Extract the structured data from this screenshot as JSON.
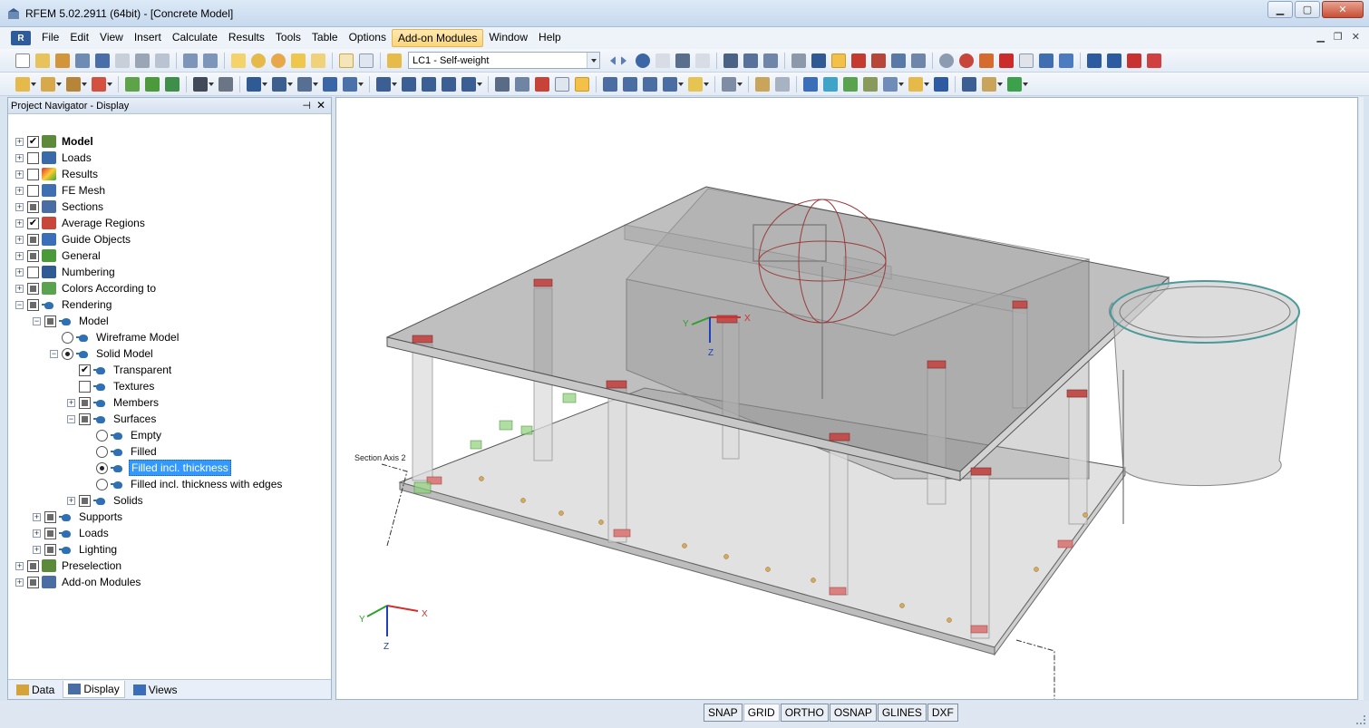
{
  "window": {
    "title": "RFEM 5.02.2911 (64bit) - [Concrete Model]",
    "minimize": "▁",
    "maximize": "▢",
    "close": "✕"
  },
  "menu": {
    "items": [
      {
        "label": "File"
      },
      {
        "label": "Edit"
      },
      {
        "label": "View"
      },
      {
        "label": "Insert"
      },
      {
        "label": "Calculate"
      },
      {
        "label": "Results"
      },
      {
        "label": "Tools"
      },
      {
        "label": "Table"
      },
      {
        "label": "Options"
      },
      {
        "label": "Add-on Modules",
        "active": true
      },
      {
        "label": "Window"
      },
      {
        "label": "Help"
      }
    ],
    "mdi_min": "▁",
    "mdi_restore": "❐",
    "mdi_close": "✕"
  },
  "toolbar": {
    "load_case": "LC1 - Self-weight"
  },
  "navigator": {
    "title": "Project Navigator - Display",
    "pin": "⊣",
    "close": "✕",
    "tree": [
      {
        "label": "Model",
        "level": 0,
        "expander": "+",
        "check": "checked",
        "icon": "model-icon",
        "bold": true
      },
      {
        "label": "Loads",
        "level": 0,
        "expander": "+",
        "check": "unchecked",
        "icon": "loads-icon"
      },
      {
        "label": "Results",
        "level": 0,
        "expander": "+",
        "check": "unchecked",
        "icon": "results-icon"
      },
      {
        "label": "FE Mesh",
        "level": 0,
        "expander": "+",
        "check": "unchecked",
        "icon": "fe-mesh-icon"
      },
      {
        "label": "Sections",
        "level": 0,
        "expander": "+",
        "check": "partial",
        "icon": "sections-icon"
      },
      {
        "label": "Average Regions",
        "level": 0,
        "expander": "+",
        "check": "checked",
        "icon": "average-regions-icon"
      },
      {
        "label": "Guide Objects",
        "level": 0,
        "expander": "+",
        "check": "partial",
        "icon": "guide-objects-icon"
      },
      {
        "label": "General",
        "level": 0,
        "expander": "+",
        "check": "partial",
        "icon": "general-icon"
      },
      {
        "label": "Numbering",
        "level": 0,
        "expander": "+",
        "check": "unchecked",
        "icon": "numbering-icon"
      },
      {
        "label": "Colors According to",
        "level": 0,
        "expander": "+",
        "check": "partial",
        "icon": "colors-icon"
      },
      {
        "label": "Rendering",
        "level": 0,
        "expander": "−",
        "check": "partial",
        "icon": "teapot-icon"
      },
      {
        "label": "Model",
        "level": 1,
        "expander": "−",
        "check": "partial",
        "icon": "teapot-icon"
      },
      {
        "label": "Wireframe Model",
        "level": 2,
        "expander": "",
        "radio": "off",
        "icon": "teapot-icon"
      },
      {
        "label": "Solid Model",
        "level": 2,
        "expander": "−",
        "radio": "on",
        "icon": "teapot-icon"
      },
      {
        "label": "Transparent",
        "level": 3,
        "expander": "",
        "check": "checked",
        "icon": "teapot-icon"
      },
      {
        "label": "Textures",
        "level": 3,
        "expander": "",
        "check": "unchecked",
        "icon": "teapot-icon"
      },
      {
        "label": "Members",
        "level": 3,
        "expander": "+",
        "check": "partial",
        "icon": "teapot-icon"
      },
      {
        "label": "Surfaces",
        "level": 3,
        "expander": "−",
        "check": "partial",
        "icon": "teapot-icon"
      },
      {
        "label": "Empty",
        "level": 4,
        "expander": "",
        "radio": "off",
        "icon": "teapot-icon"
      },
      {
        "label": "Filled",
        "level": 4,
        "expander": "",
        "radio": "off",
        "icon": "teapot-icon"
      },
      {
        "label": "Filled incl. thickness",
        "level": 4,
        "expander": "",
        "radio": "on",
        "icon": "teapot-icon",
        "selected": true
      },
      {
        "label": "Filled incl. thickness with edges",
        "level": 4,
        "expander": "",
        "radio": "off",
        "icon": "teapot-icon"
      },
      {
        "label": "Solids",
        "level": 3,
        "expander": "+",
        "check": "partial",
        "icon": "teapot-icon"
      },
      {
        "label": "Supports",
        "level": 1,
        "expander": "+",
        "check": "partial",
        "icon": "teapot-icon"
      },
      {
        "label": "Loads",
        "level": 1,
        "expander": "+",
        "check": "partial",
        "icon": "teapot-icon"
      },
      {
        "label": "Lighting",
        "level": 1,
        "expander": "+",
        "check": "partial",
        "icon": "teapot-icon"
      },
      {
        "label": "Preselection",
        "level": 0,
        "expander": "+",
        "check": "partial",
        "icon": "preselection-icon"
      },
      {
        "label": "Add-on Modules",
        "level": 0,
        "expander": "+",
        "check": "partial",
        "icon": "add-on-modules-icon"
      }
    ],
    "tabs": [
      {
        "label": "Data",
        "icon": "data-icon"
      },
      {
        "label": "Display",
        "icon": "display-icon",
        "active": true
      },
      {
        "label": "Views",
        "icon": "views-icon"
      }
    ]
  },
  "canvas": {
    "section_axis_label": "Section Axis 2",
    "axis_x": "X",
    "axis_y": "Y",
    "axis_z": "Z"
  },
  "status": {
    "buttons": [
      {
        "label": "SNAP"
      },
      {
        "label": "GRID",
        "pressed": true
      },
      {
        "label": "ORTHO"
      },
      {
        "label": "OSNAP"
      },
      {
        "label": "GLINES"
      },
      {
        "label": "DXF"
      }
    ]
  }
}
